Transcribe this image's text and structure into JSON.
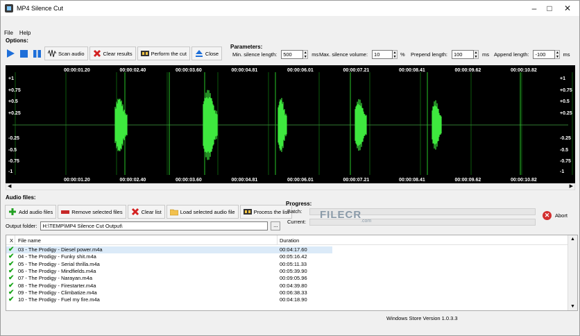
{
  "window": {
    "title": "MP4 Silence Cut"
  },
  "menu": {
    "file": "File",
    "help": "Help"
  },
  "options_label": "Options:",
  "toolbar": {
    "scan": "Scan audio",
    "clear": "Clear results",
    "cut": "Perform the cut",
    "close": "Close"
  },
  "parameters": {
    "label": "Parameters:",
    "min_silence_label": "Min. silence length:",
    "min_silence_value": "500",
    "min_silence_unit": "ms",
    "max_volume_label": "Max. silence volume:",
    "max_volume_value": "10",
    "max_volume_unit": "%",
    "prepend_label": "Prepend length:",
    "prepend_value": "100",
    "prepend_unit": "ms",
    "append_label": "Append length:",
    "append_value": "-100",
    "append_unit": "ms"
  },
  "waveform": {
    "timestamps": [
      "00:00:01.20",
      "00:00:02.40",
      "00:00:03.60",
      "00:00:04.81",
      "00:00:06.01",
      "00:00:07.21",
      "00:00:08.41",
      "00:00:09.62",
      "00:00:10.82"
    ],
    "y_labels": [
      "+1",
      "+0.75",
      "+0.5",
      "+0.25",
      "-0.25",
      "-0.5",
      "-0.75",
      "-1"
    ],
    "wave_color": "#3ee83e"
  },
  "audio_files_label": "Audio files:",
  "file_toolbar": {
    "add": "Add audio files",
    "remove": "Remove selected files",
    "clear": "Clear list",
    "load": "Load selected audio file",
    "process": "Process the list"
  },
  "progress": {
    "label": "Progress:",
    "batch": "Batch:",
    "current": "Current:",
    "abort": "Abort"
  },
  "output": {
    "label": "Output folder:",
    "value": "H:\\TEMP\\MP4 Silence Cut Output\\",
    "browse": "..."
  },
  "list": {
    "col_x": "X",
    "col_name": "File name",
    "col_duration": "Duration",
    "rows": [
      {
        "name": "03 - The Prodigy - Diesel power.m4a",
        "duration": "00:04:17.60"
      },
      {
        "name": "04 - The Prodigy - Funky shit.m4a",
        "duration": "00:05:16.42"
      },
      {
        "name": "05 - The Prodigy - Serial thrilla.m4a",
        "duration": "00:05:11.33"
      },
      {
        "name": "06 - The Prodigy - Mindfields.m4a",
        "duration": "00:05:39.90"
      },
      {
        "name": "07 - The Prodigy - Narayan.m4a",
        "duration": "00:09:05.96"
      },
      {
        "name": "08 - The Prodigy - Firestarter.m4a",
        "duration": "00:04:39.80"
      },
      {
        "name": "09 - The Prodigy - Climbatize.m4a",
        "duration": "00:06:38.33"
      },
      {
        "name": "10 - The Prodigy - Fuel my fire.m4a",
        "duration": "00:04:18.90"
      }
    ]
  },
  "status": {
    "version": "Windows Store Version 1.0.3.3"
  },
  "watermark": {
    "brand": "FILECR",
    "domain": ".com"
  }
}
